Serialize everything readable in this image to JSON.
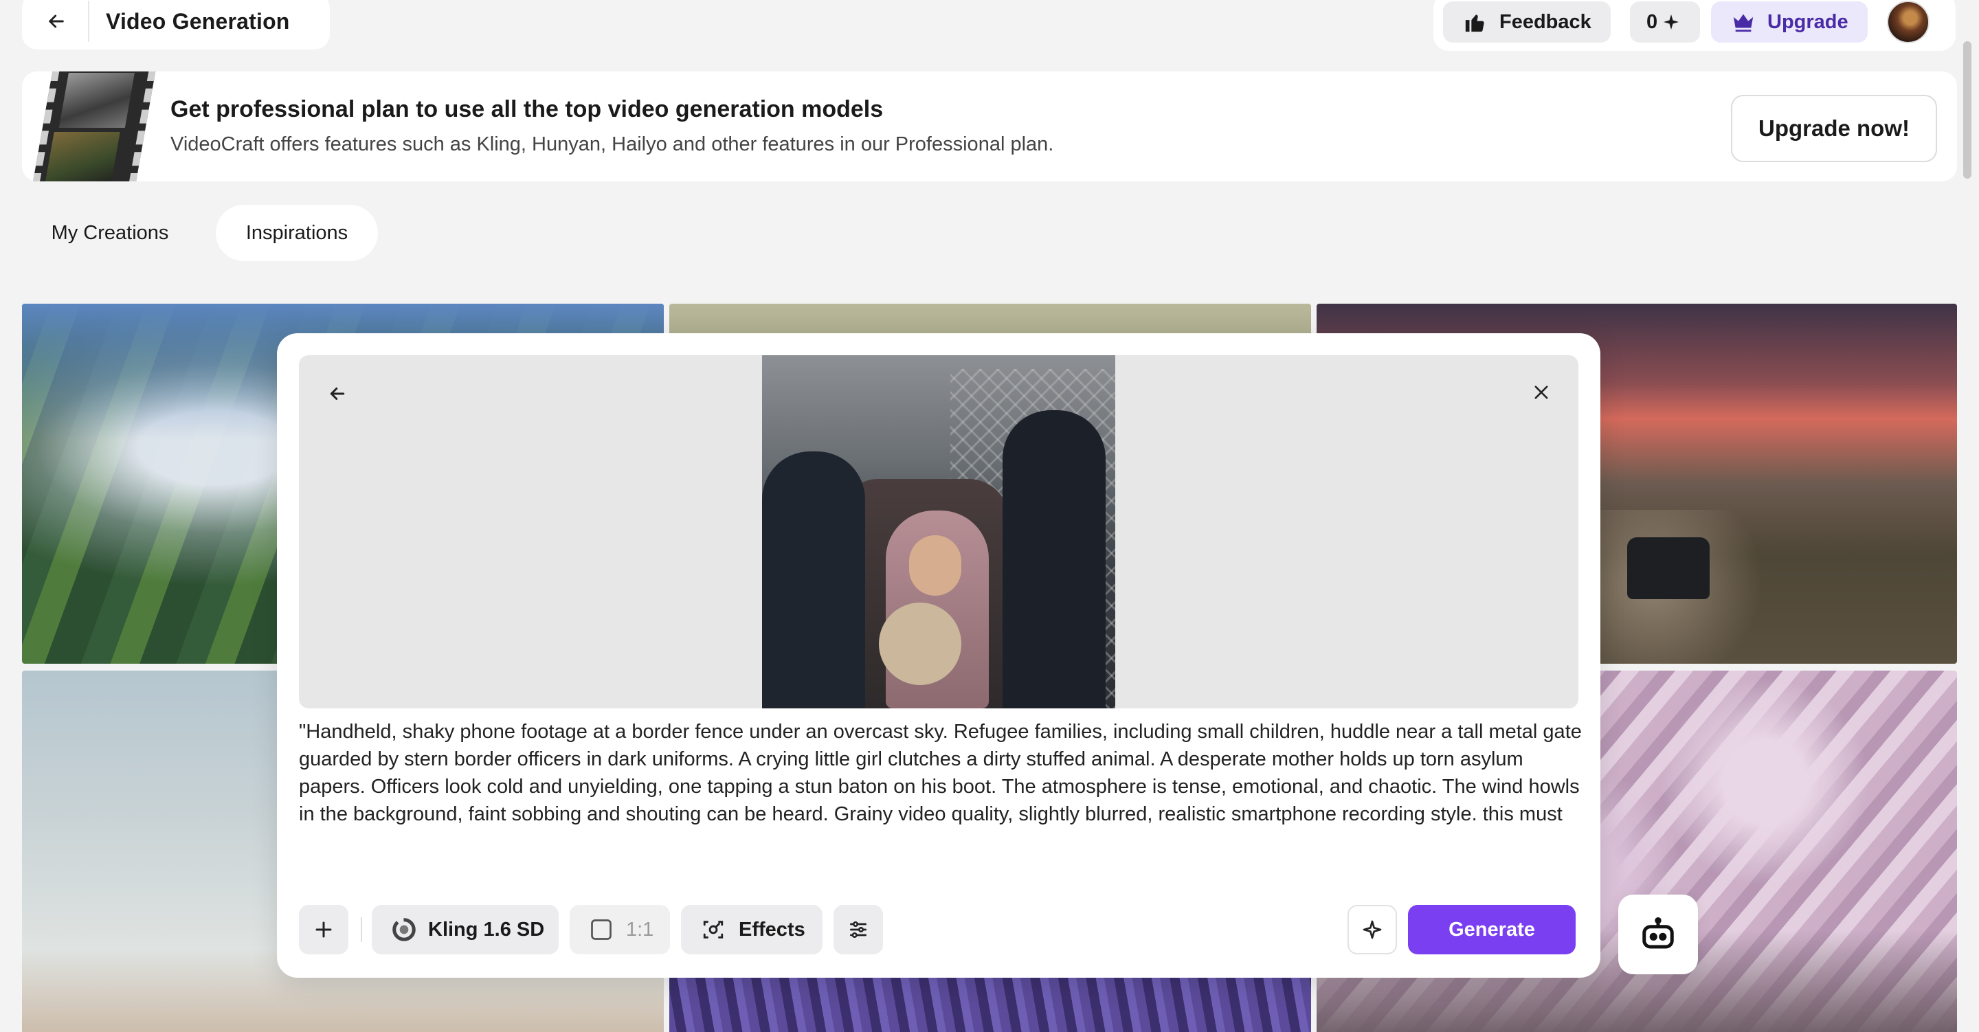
{
  "header": {
    "title": "Video Generation",
    "feedback_label": "Feedback",
    "credits_value": "0",
    "credits_icon": "sparkle-icon",
    "upgrade_label": "Upgrade"
  },
  "banner": {
    "headline": "Get professional plan to use all the top video generation models",
    "subtext": "VideoCraft offers features such as Kling, Hunyan, Hailyo and other features in our Professional plan.",
    "cta_label": "Upgrade now!"
  },
  "tabs": [
    {
      "label": "My Creations",
      "active": false
    },
    {
      "label": "Inspirations",
      "active": true
    }
  ],
  "modal": {
    "prompt": "\"Handheld, shaky phone footage at a border fence under an overcast sky. Refugee families, including small children, huddle near a tall metal gate guarded by stern border officers in dark uniforms. A crying little girl clutches a dirty stuffed animal. A desperate mother holds up torn asylum papers. Officers look cold and unyielding, one tapping a stun baton on his boot. The atmosphere is tense, emotional, and chaotic. The wind howls in the background, faint sobbing and shouting can be heard. Grainy video quality, slightly blurred, realistic smartphone recording style. this must take place to the borders Greece Turkey at the islands. So have in mind the greek uniforms for the officers.",
    "model_label": "Kling 1.6 SD",
    "ratio_label": "1:1",
    "effects_label": "Effects",
    "generate_label": "Generate"
  },
  "colors": {
    "accent": "#7a3ff0",
    "upgrade_bg": "#ece8fb",
    "upgrade_text": "#4a2ba6",
    "page_bg": "#f3f3f4"
  }
}
